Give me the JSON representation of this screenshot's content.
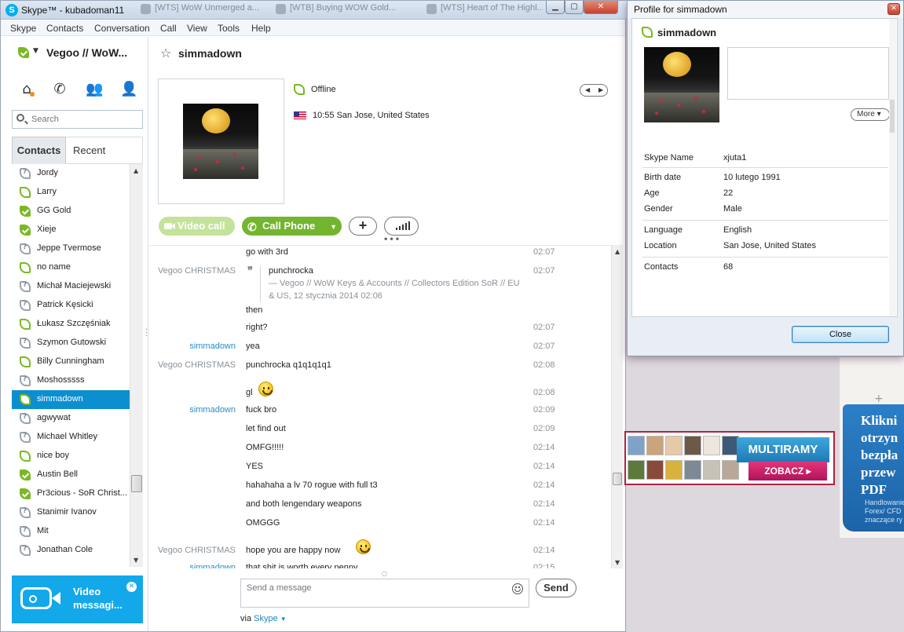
{
  "window": {
    "title": "Skype™ - kubadoman11",
    "background_tabs": [
      "[WTS] WoW Unmerged a...",
      "[WTB] Buying WOW Gold...",
      "[WTS] Heart of The Highl..."
    ]
  },
  "menu": [
    "Skype",
    "Contacts",
    "Conversation",
    "Call",
    "View",
    "Tools",
    "Help"
  ],
  "sidebar": {
    "profile_name": "Vegoo // WoW...",
    "search_placeholder": "Search",
    "tabs": [
      "Contacts",
      "Recent"
    ],
    "contacts": [
      {
        "name": "Jordy",
        "status": "unknown"
      },
      {
        "name": "Larry",
        "status": "offline"
      },
      {
        "name": "GG Gold",
        "status": "online"
      },
      {
        "name": "Xieje",
        "status": "online"
      },
      {
        "name": "Jeppe Tvermose",
        "status": "unknown"
      },
      {
        "name": "no name",
        "status": "offline"
      },
      {
        "name": "Michał Maciejewski",
        "status": "unknown"
      },
      {
        "name": "Patrick Kęsicki",
        "status": "unknown"
      },
      {
        "name": "Łukasz Szczęśniak",
        "status": "offline"
      },
      {
        "name": "Szymon Gutowski",
        "status": "unknown"
      },
      {
        "name": "Billy Cunningham",
        "status": "offline"
      },
      {
        "name": "Moshosssss",
        "status": "unknown"
      },
      {
        "name": "simmadown",
        "status": "offline",
        "selected": true
      },
      {
        "name": "agwywat",
        "status": "unknown"
      },
      {
        "name": "Michael Whitley",
        "status": "unknown"
      },
      {
        "name": "nice boy",
        "status": "offline"
      },
      {
        "name": "Austin Bell",
        "status": "online"
      },
      {
        "name": "Pr3cious - SoR Christ...",
        "status": "online"
      },
      {
        "name": "Stanimir Ivanov",
        "status": "unknown"
      },
      {
        "name": "Mit",
        "status": "unknown"
      },
      {
        "name": "Jonathan Cole",
        "status": "unknown"
      }
    ],
    "video_promo": "Video messagi..."
  },
  "conversation": {
    "contact_name": "simmadown",
    "status": "Offline",
    "local_time": "10:55 San Jose, United States",
    "buttons": {
      "video_call": "Video call",
      "call_phone": "Call Phone"
    },
    "messages": [
      {
        "sender": "",
        "text": "go with 3rd",
        "time": "02:07"
      },
      {
        "sender": "Vegoo CHRISTMAS",
        "quote": {
          "text": "punchrocka",
          "source": "— Vegoo // WoW Keys & Accounts // Collectors Edition SoR // EU & US, 12 stycznia 2014 02:06"
        },
        "text": "then",
        "time": "02:07"
      },
      {
        "sender": "",
        "text": "right?",
        "time": "02:07"
      },
      {
        "sender": "simmadown",
        "self": true,
        "text": "yea",
        "time": "02:07"
      },
      {
        "sender": "Vegoo CHRISTMAS",
        "text": "punchrocka q1q1q1q1",
        "time": "02:08"
      },
      {
        "sender": "",
        "text": "gl",
        "emoji": "smiley",
        "time": "02:08"
      },
      {
        "sender": "simmadown",
        "self": true,
        "text": "fuck bro",
        "time": "02:09"
      },
      {
        "sender": "",
        "text": "let find out",
        "time": "02:09"
      },
      {
        "sender": "",
        "text": "OMFG!!!!!",
        "time": "02:14"
      },
      {
        "sender": "",
        "text": "YES",
        "time": "02:14"
      },
      {
        "sender": "",
        "text": "hahahaha a lv 70 rogue with full t3",
        "time": "02:14"
      },
      {
        "sender": "",
        "text": "and both lengendary weapons",
        "time": "02:14"
      },
      {
        "sender": "",
        "text": "OMGGG",
        "time": "02:14"
      },
      {
        "sender": "Vegoo CHRISTMAS",
        "text": "hope you are happy now",
        "emoji": "smiley",
        "time": "02:14"
      },
      {
        "sender": "simmadown",
        "self": true,
        "text": "that shit is worth every penny",
        "time": "02:15"
      }
    ],
    "input_placeholder": "Send a message",
    "send_label": "Send",
    "via_prefix": "via",
    "via_link": "Skype"
  },
  "profile_dialog": {
    "title": "Profile for simmadown",
    "name": "simmadown",
    "more_label": "More",
    "fields": [
      {
        "label": "Skype Name",
        "value": "xjuta1"
      },
      {
        "label": "Birth date",
        "value": "10 lutego 1991"
      },
      {
        "label": "Age",
        "value": "22"
      },
      {
        "label": "Gender",
        "value": "Male"
      },
      {
        "label": "Language",
        "value": "English"
      },
      {
        "label": "Location",
        "value": "San Jose, United States"
      },
      {
        "label": "Contacts",
        "value": "68"
      }
    ],
    "close_label": "Close"
  },
  "web_ads": {
    "banner_title": "MULTIRAMY",
    "banner_button": "ZOBACZ",
    "side_headline": "Klikni otrzyn bezpła przew PDF",
    "side_small": "Handlowanie Forex/ CFD znaczące ry"
  },
  "colors": {
    "skype_blue": "#00aff0",
    "status_green": "#7ab824",
    "selected_row": "#0c8fcf",
    "call_green": "#73b52e",
    "self_sender": "#2b8cc4"
  }
}
